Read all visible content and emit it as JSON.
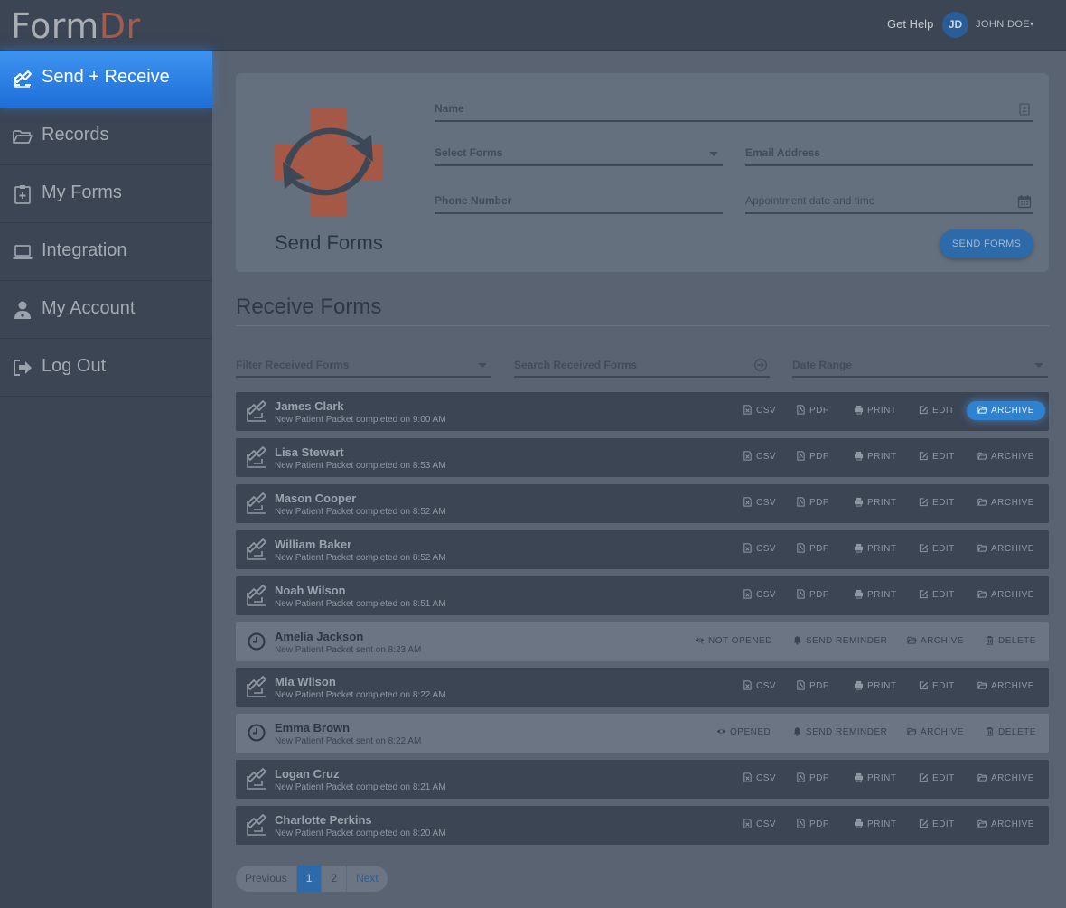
{
  "header": {
    "logo_part1": "Form",
    "logo_part2": "Dr",
    "get_help": "Get Help",
    "avatar_initials": "JD",
    "user_name": "JOHN DOE",
    "user_caret": "▾"
  },
  "sidebar": {
    "items": [
      {
        "label": "Send + Receive",
        "icon": "send-receive-icon",
        "active": true
      },
      {
        "label": "Records",
        "icon": "folder-open-icon"
      },
      {
        "label": "My Forms",
        "icon": "clipboard-plus-icon"
      },
      {
        "label": "Integration",
        "icon": "laptop-icon"
      },
      {
        "label": "My Account",
        "icon": "user-md-icon"
      },
      {
        "label": "Log Out",
        "icon": "sign-out-icon"
      }
    ]
  },
  "send_forms": {
    "title": "Send Forms",
    "name_label": "Name",
    "select_forms_label": "Select Forms",
    "email_label": "Email Address",
    "phone_label": "Phone Number",
    "appointment_label": "Appointment date and time",
    "send_button": "SEND FORMS"
  },
  "receive_forms": {
    "title": "Receive Forms",
    "filter_label": "Filter Received Forms",
    "search_label": "Search Received Forms",
    "date_range_label": "Date Range",
    "action_labels": {
      "csv": "CSV",
      "pdf": "PDF",
      "print": "PRINT",
      "edit": "EDIT",
      "archive": "ARCHIVE",
      "send_reminder": "SEND REMINDER",
      "delete": "DELETE"
    },
    "rows": [
      {
        "name": "James Clark",
        "detail": "New Patient Packet completed on 9:00 AM",
        "status": "completed"
      },
      {
        "name": "Lisa Stewart",
        "detail": "New Patient Packet completed on 8:53 AM",
        "status": "completed"
      },
      {
        "name": "Mason Cooper",
        "detail": "New Patient Packet completed on 8:52 AM",
        "status": "completed"
      },
      {
        "name": "William Baker",
        "detail": "New Patient Packet completed on 8:52 AM",
        "status": "completed"
      },
      {
        "name": "Noah Wilson",
        "detail": "New Patient Packet completed on 8:51 AM",
        "status": "completed"
      },
      {
        "name": "Amelia Jackson",
        "detail": "New Patient Packet sent on 8:23 AM",
        "status": "sent",
        "open_state": "NOT OPENED"
      },
      {
        "name": "Mia Wilson",
        "detail": "New Patient Packet completed on 8:22 AM",
        "status": "completed"
      },
      {
        "name": "Emma Brown",
        "detail": "New Patient Packet sent on 8:22 AM",
        "status": "sent",
        "open_state": "OPENED"
      },
      {
        "name": "Logan Cruz",
        "detail": "New Patient Packet completed on 8:21 AM",
        "status": "completed"
      },
      {
        "name": "Charlotte Perkins",
        "detail": "New Patient Packet completed on 8:20 AM",
        "status": "completed"
      }
    ]
  },
  "pagination": {
    "previous": "Previous",
    "pages": [
      "1",
      "2"
    ],
    "current": "1",
    "next": "Next"
  },
  "colors": {
    "accent": "#2e82d0",
    "sidebar_bg": "#3b4554",
    "logo_red": "#a45c4c"
  }
}
